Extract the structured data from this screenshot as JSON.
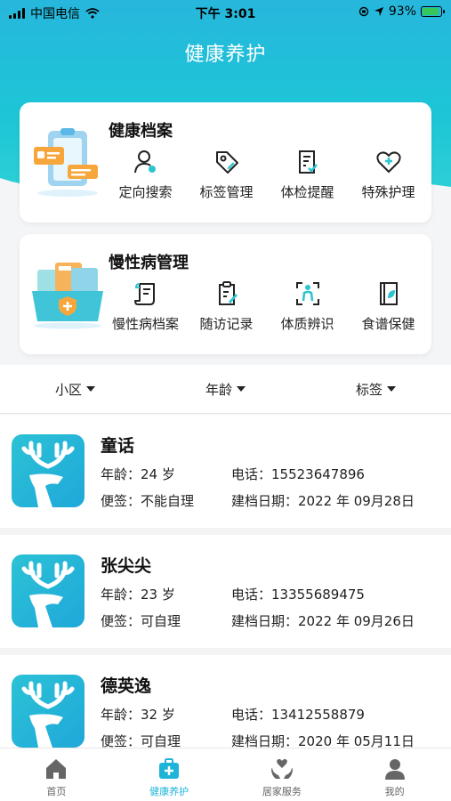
{
  "status_bar": {
    "carrier": "中国电信",
    "time": "下午 3:01",
    "battery": "93%"
  },
  "header": {
    "title": "健康养护"
  },
  "health_records": {
    "title": "健康档案",
    "items": [
      {
        "label": "定向搜索",
        "icon": "person-search-icon"
      },
      {
        "label": "标签管理",
        "icon": "tag-icon"
      },
      {
        "label": "体检提醒",
        "icon": "checkup-doc-icon"
      },
      {
        "label": "特殊护理",
        "icon": "heart-plus-icon"
      }
    ]
  },
  "chronic": {
    "title": "慢性病管理",
    "items": [
      {
        "label": "慢性病档案",
        "icon": "scroll-icon"
      },
      {
        "label": "随访记录",
        "icon": "clipboard-edit-icon"
      },
      {
        "label": "体质辨识",
        "icon": "body-scan-icon"
      },
      {
        "label": "食谱保健",
        "icon": "recipe-book-icon"
      }
    ]
  },
  "filters": [
    {
      "label": "小区"
    },
    {
      "label": "年龄"
    },
    {
      "label": "标签"
    }
  ],
  "residents": [
    {
      "name": "童话",
      "age": "年龄：24 岁",
      "phone": "电话：15523647896",
      "note": "便签：不能自理",
      "date": "建档日期：2022 年 09月28日"
    },
    {
      "name": "张尖尖",
      "age": "年龄：23 岁",
      "phone": "电话：13355689475",
      "note": "便签：可自理",
      "date": "建档日期：2022 年 09月26日"
    },
    {
      "name": "德英逸",
      "age": "年龄：32 岁",
      "phone": "电话：13412558879",
      "note": "便签：可自理",
      "date": "建档日期：2020 年 05月11日"
    }
  ],
  "tabs": [
    {
      "label": "首页",
      "icon": "home-icon"
    },
    {
      "label": "健康养护",
      "icon": "medical-kit-icon"
    },
    {
      "label": "居家服务",
      "icon": "hands-heart-icon"
    },
    {
      "label": "我的",
      "icon": "user-icon"
    }
  ],
  "colors": {
    "accent": "#1eb4d8",
    "header_top": "#27b7dc",
    "header_bottom": "#33d2d5"
  }
}
